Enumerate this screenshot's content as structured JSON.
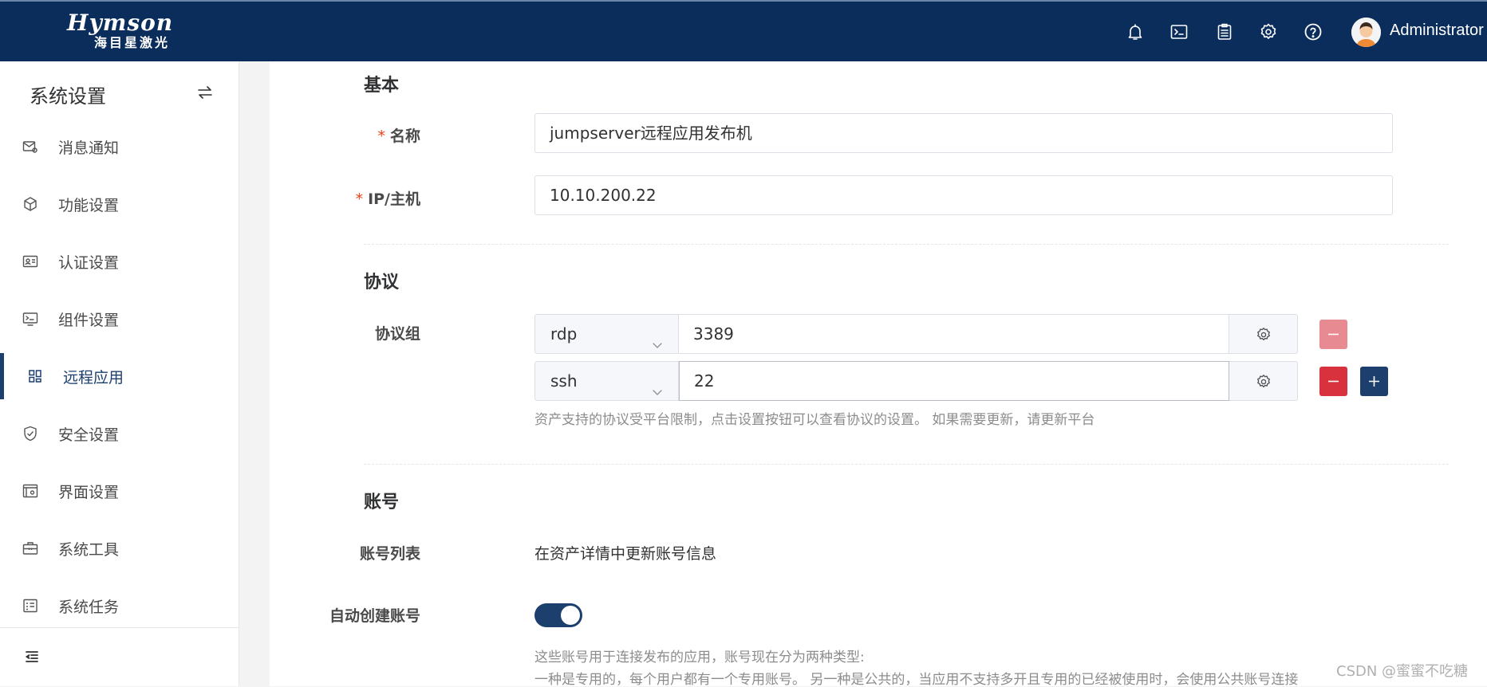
{
  "header": {
    "logo_en": "Hymson",
    "logo_cn": "海目星激光",
    "username": "Administrator",
    "icons": [
      "bell-icon",
      "terminal-icon",
      "clipboard-icon",
      "gear-icon",
      "help-icon"
    ]
  },
  "sidebar": {
    "title": "系统设置",
    "items": [
      {
        "label": "消息通知",
        "icon": "mail-settings-icon"
      },
      {
        "label": "功能设置",
        "icon": "cube-icon"
      },
      {
        "label": "认证设置",
        "icon": "id-card-icon"
      },
      {
        "label": "组件设置",
        "icon": "terminal-icon"
      },
      {
        "label": "远程应用",
        "icon": "apps-icon",
        "active": true
      },
      {
        "label": "安全设置",
        "icon": "shield-icon"
      },
      {
        "label": "界面设置",
        "icon": "window-settings-icon"
      },
      {
        "label": "系统工具",
        "icon": "toolbox-icon"
      },
      {
        "label": "系统任务",
        "icon": "task-list-icon"
      }
    ]
  },
  "form": {
    "basic": {
      "title": "基本",
      "name_label": "名称",
      "name_value": "jumpserver远程应用发布机",
      "ip_label": "IP/主机",
      "ip_value": "10.10.200.22"
    },
    "protocol": {
      "title": "协议",
      "group_label": "协议组",
      "rows": [
        {
          "protocol": "rdp",
          "port": "3389"
        },
        {
          "protocol": "ssh",
          "port": "22"
        }
      ],
      "help": "资产支持的协议受平台限制，点击设置按钮可以查看协议的设置。 如果需要更新，请更新平台"
    },
    "account": {
      "title": "账号",
      "list_label": "账号列表",
      "list_value": "在资产详情中更新账号信息",
      "auto_create_label": "自动创建账号",
      "auto_create_on": true,
      "help_line1": "这些账号用于连接发布的应用，账号现在分为两种类型:",
      "help_line2": "一种是专用的，每个用户都有一个专用账号。 另一种是公共的，当应用不支持多开且专用的已经被使用时，会使用公共账号连接"
    }
  },
  "watermark": "CSDN @蜜蜜不吃糖",
  "colors": {
    "header_bg": "#0b2d5b",
    "accent": "#1c3f6e",
    "danger": "#d9323f",
    "required": "#ed4014"
  }
}
